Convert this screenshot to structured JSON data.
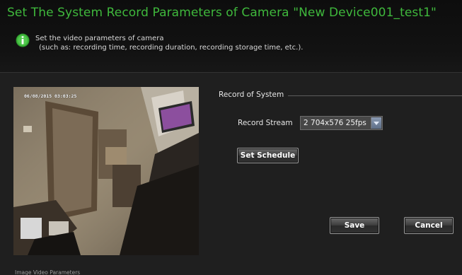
{
  "dialog": {
    "title": "Set The System Record Parameters of Camera \"New Device001_test1\"",
    "description_line1": "Set the video parameters of camera",
    "description_line2": "(such as: recording time, recording duration, recording storage time, etc.).",
    "info_icon": "info-icon"
  },
  "preview": {
    "timestamp": "06/08/2015 03:03:25",
    "label": "Image Video Parameters"
  },
  "record_group": {
    "legend": "Record of System",
    "stream_label": "Record Stream",
    "stream_value": "2 704x576 25fps",
    "dropdown_icon": "chevron-down-icon",
    "schedule_button": "Set Schedule"
  },
  "actions": {
    "save": "Save",
    "cancel": "Cancel"
  },
  "colors": {
    "title": "#3fb83c",
    "background": "#1f1f1f",
    "info_icon": "#3fb83c"
  }
}
